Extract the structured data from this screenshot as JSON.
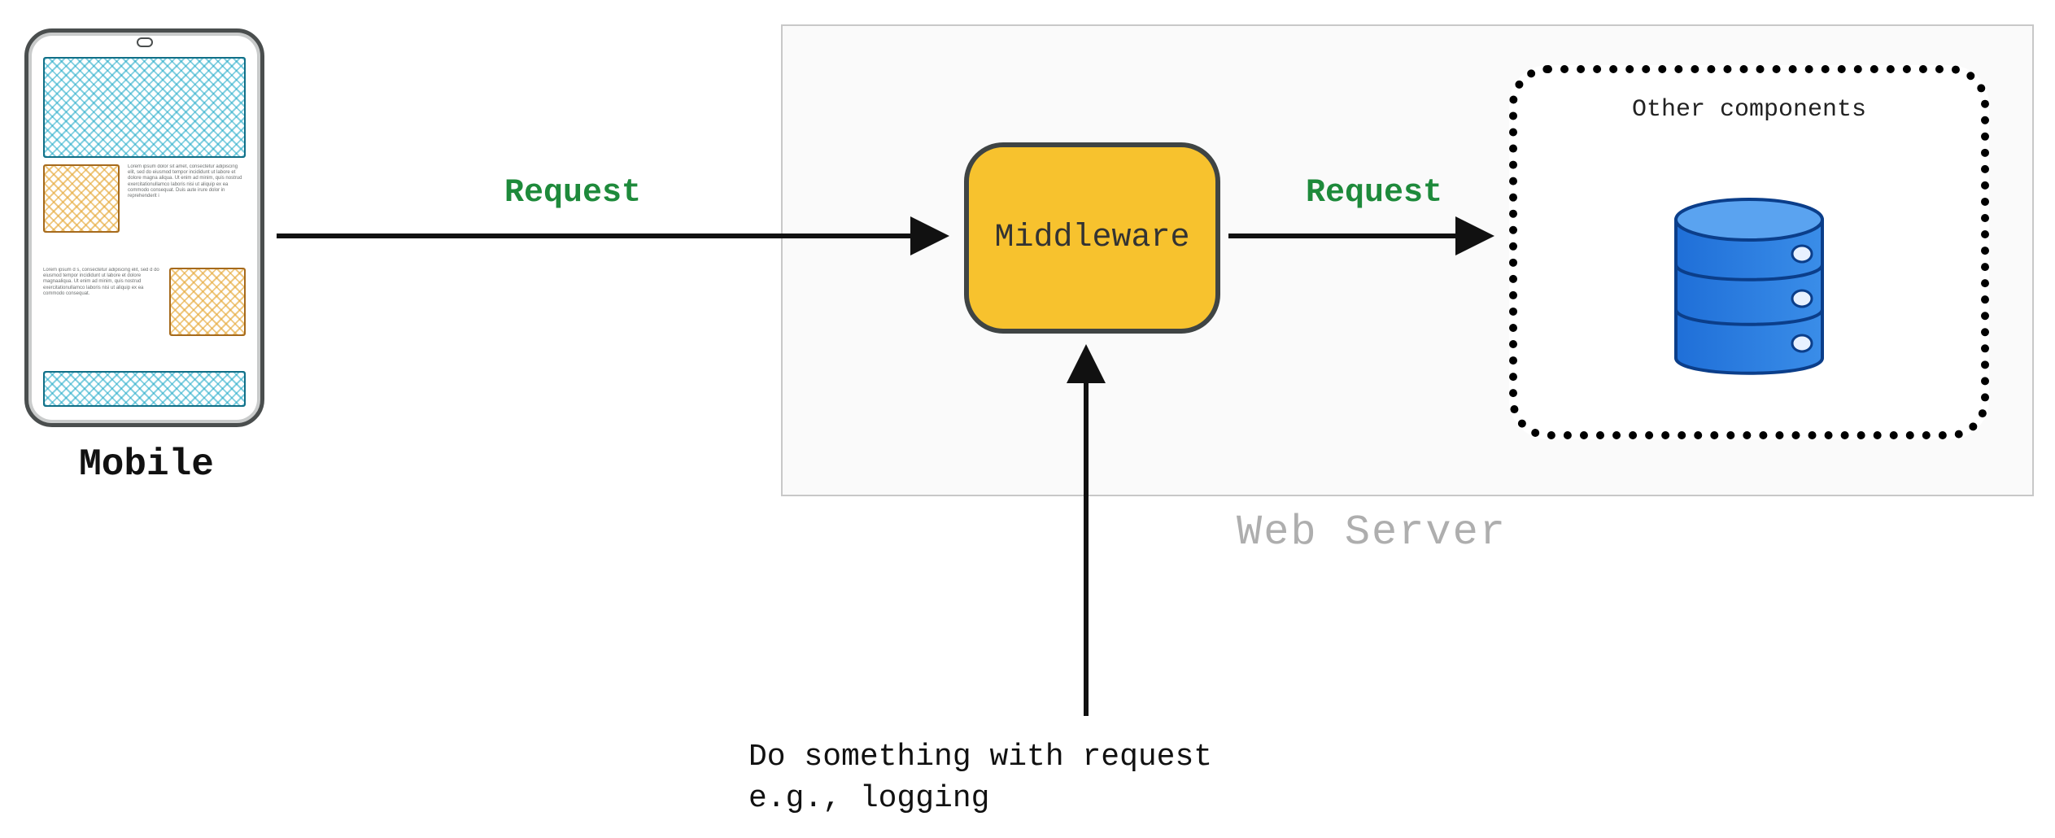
{
  "mobile": {
    "label": "Mobile",
    "lorem1": "Lorem ipsum dolor sit amet, consectetur adipiscing elit, sed do eiusmod tempor incididunt ut labore et dolore magna aliqua. Ut enim ad minim, quis nostrud exercitationullamco laboris nisi ut aliquip ex ea commodo consequat. Duis aute irure dolor in reprehenderit i",
    "lorem2": "Lorem ipsum d s, consectetur adipiscing elit, sed d do eiusmod tempor incididunt ut labore et dolore magnaaliqua. Ut enim ad minim, quis nostrud exercitationullamco laboris nisi ut aliquip ex ea commodo consequat."
  },
  "webserver": {
    "label": "Web Server"
  },
  "middleware": {
    "label": "Middleware"
  },
  "other": {
    "label": "Other components"
  },
  "arrows": {
    "request1": "Request",
    "request2": "Request"
  },
  "note": {
    "line1": "Do something with request",
    "line2": "e.g., logging"
  }
}
